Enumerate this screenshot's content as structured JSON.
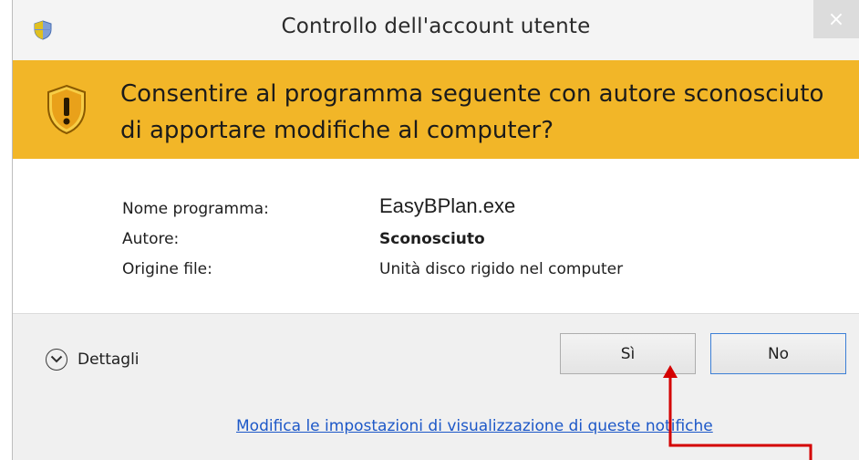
{
  "dialog": {
    "title": "Controllo dell'account utente",
    "close_glyph": "×",
    "question": "Consentire al programma seguente con autore sconosciuto di apportare modifiche al computer?",
    "details": [
      {
        "label": "Nome programma:",
        "value": "EasyBPlan.exe"
      },
      {
        "label": "Autore:",
        "value": "Sconosciuto"
      },
      {
        "label": "Origine file:",
        "value": "Unità disco rigido nel computer"
      }
    ],
    "details_toggle": "Dettagli",
    "buttons": {
      "yes": "Sì",
      "no": "No"
    },
    "link": "Modifica le impostazioni di visualizzazione di queste notifiche"
  },
  "colors": {
    "banner": "#f2b628",
    "link": "#1d58c8",
    "annotation_arrow": "#d40000",
    "no_button_border": "#3c7fd6"
  },
  "icons": [
    "uac-shield-icon",
    "warning-shield-icon",
    "close-icon",
    "chevron-down-icon"
  ]
}
